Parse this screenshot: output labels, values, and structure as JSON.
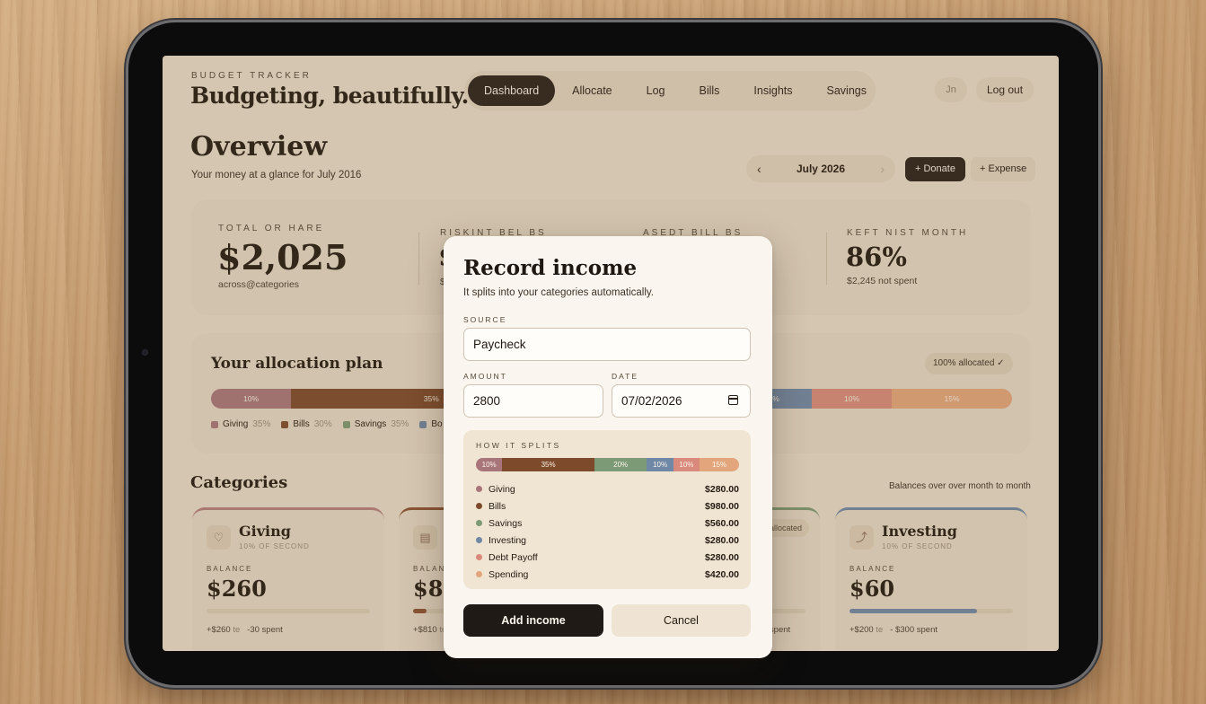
{
  "app": {
    "kicker": "BUDGET TRACKER",
    "title": "Budgeting, beautifully."
  },
  "nav": {
    "items": [
      {
        "label": "Dashboard",
        "active": true
      },
      {
        "label": "Allocate"
      },
      {
        "label": "Log"
      },
      {
        "label": "Bills"
      },
      {
        "label": "Insights"
      },
      {
        "label": "Savings"
      }
    ]
  },
  "user": {
    "initials": "Jn",
    "logout_label": "Log out"
  },
  "overview": {
    "title": "Overview",
    "subtitle": "Your money at a glance for July 2016"
  },
  "month_switch": {
    "prev_icon": "‹",
    "label": "July 2026",
    "next_icon": "›"
  },
  "actions": {
    "donate_label": "+ Donate",
    "expense_label": "+ Expense"
  },
  "summary": {
    "total_kicker": "TOTAL OR HARE",
    "total_value": "$2,025",
    "total_note": "across@categories",
    "col2_kicker": "RISKINT   BEL BS",
    "col2_value": "$",
    "col2_note": "$",
    "col3_kicker": "ASEDT   BILL BS",
    "col4_kicker": "KEFT NIST MONTH",
    "col4_value": "86%",
    "col4_note": "$2,245 not spent"
  },
  "allocation": {
    "title": "Your allocation plan",
    "badge": "100% allocated ✓",
    "segments": [
      {
        "label": "10%",
        "share": 10,
        "color": "#a8767a"
      },
      {
        "label": "35%",
        "share": 35,
        "color": "#7d4a2b"
      },
      {
        "label": "",
        "share": 20,
        "color": "#7d9a76"
      },
      {
        "label": "10%",
        "share": 10,
        "color": "#6f88a6"
      },
      {
        "label": "10%",
        "share": 10,
        "color": "#d98a7c"
      },
      {
        "label": "15%",
        "share": 15,
        "color": "#e3a67c"
      }
    ],
    "legend": [
      {
        "name": "Giving",
        "pct": "35%",
        "color": "#a8767a"
      },
      {
        "name": "Bills",
        "pct": "30%",
        "color": "#7d4a2b"
      },
      {
        "name": "Savings",
        "pct": "35%",
        "color": "#7d9a76"
      },
      {
        "name": "Bo",
        "pct": "",
        "color": "#6f88a6"
      }
    ]
  },
  "categories": {
    "title": "Categories",
    "hint": "Balances over over month to month",
    "cards": [
      {
        "name": "Giving",
        "share": "10% OF SECOND",
        "icon": "♡",
        "balance_kicker": "BALANCE",
        "balance": "$260",
        "fill": 0.0,
        "inflow": "+$260",
        "inflow_tag": "te",
        "spent": "-30 spent",
        "accent": "#b57f7f"
      },
      {
        "name": "",
        "share": "",
        "icon": "▤",
        "balance_kicker": "BALANC",
        "balance": "$83",
        "fill": 0.08,
        "inflow": "+$810",
        "inflow_tag": "te",
        "spent": "",
        "accent": "#8c5232"
      },
      {
        "name": "",
        "share": "",
        "icon": "",
        "balance_kicker": "",
        "balance": "",
        "fill": 0.0,
        "inflow": "",
        "inflow_tag": "",
        "spent": "0 spent",
        "accent": "#7d9a76",
        "badge": "allocated"
      },
      {
        "name": "Investing",
        "share": "10% OF SECOND",
        "icon": "⤴",
        "balance_kicker": "BALANCE",
        "balance": "$60",
        "fill": 0.78,
        "inflow": "+$200",
        "inflow_tag": "te",
        "spent": "- $300 spent",
        "accent": "#6f88a6"
      }
    ]
  },
  "modal": {
    "title": "Record income",
    "subtitle": "It splits into your categories automatically.",
    "source_label": "SOURCE",
    "source_value": "Paycheck",
    "amount_label": "AMOUNT",
    "amount_value": "2800",
    "date_label": "DATE",
    "date_value": "07/02/2026",
    "split_kicker": "HOW IT SPLITS",
    "split_segments": [
      {
        "label": "10%",
        "share": 10,
        "color": "#a8767a"
      },
      {
        "label": "35%",
        "share": 35,
        "color": "#7d4a2b"
      },
      {
        "label": "20%",
        "share": 20,
        "color": "#7d9a76"
      },
      {
        "label": "10%",
        "share": 10,
        "color": "#6f88a6"
      },
      {
        "label": "10%",
        "share": 10,
        "color": "#d98a7c"
      },
      {
        "label": "15%",
        "share": 15,
        "color": "#e3a67c"
      }
    ],
    "split_rows": [
      {
        "name": "Giving",
        "amount": "$280.00",
        "color": "#a8767a"
      },
      {
        "name": "Bills",
        "amount": "$980.00",
        "color": "#7d4a2b"
      },
      {
        "name": "Savings",
        "amount": "$560.00",
        "color": "#7d9a76"
      },
      {
        "name": "Investing",
        "amount": "$280.00",
        "color": "#6f88a6"
      },
      {
        "name": "Debt Payoff",
        "amount": "$280.00",
        "color": "#d98a7c"
      },
      {
        "name": "Spending",
        "amount": "$420.00",
        "color": "#e3a67c"
      }
    ],
    "add_label": "Add income",
    "cancel_label": "Cancel"
  }
}
